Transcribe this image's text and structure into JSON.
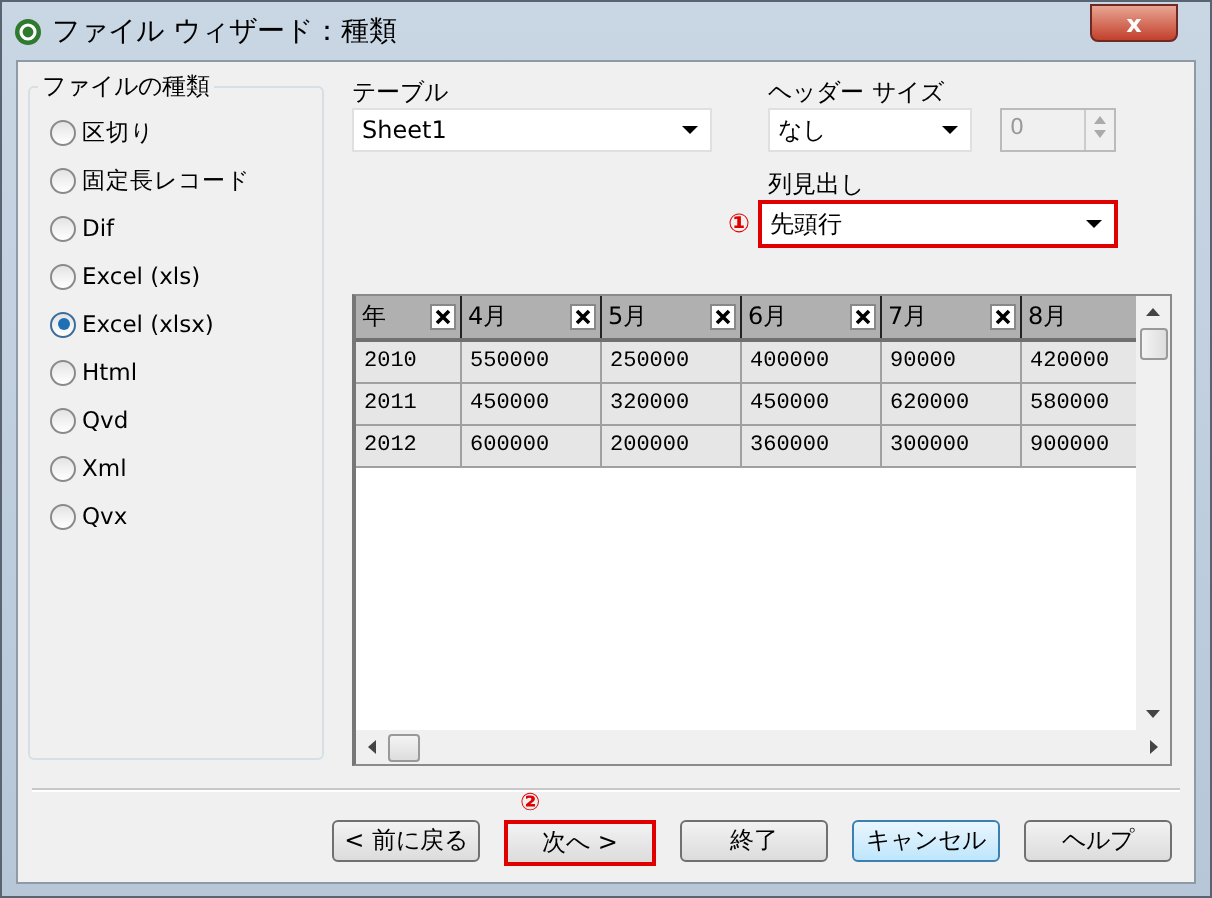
{
  "window": {
    "title": "ファイル ウィザード：種類",
    "close_label": "x"
  },
  "file_types": {
    "label": "ファイルの種類",
    "options": [
      {
        "label": "区切り",
        "selected": false
      },
      {
        "label": "固定長レコード",
        "selected": false
      },
      {
        "label": "Dif",
        "selected": false
      },
      {
        "label": "Excel (xls)",
        "selected": false
      },
      {
        "label": "Excel (xlsx)",
        "selected": true
      },
      {
        "label": "Html",
        "selected": false
      },
      {
        "label": "Qvd",
        "selected": false
      },
      {
        "label": "Xml",
        "selected": false
      },
      {
        "label": "Qvx",
        "selected": false
      }
    ]
  },
  "table_field": {
    "label": "テーブル",
    "value": "Sheet1"
  },
  "header_size": {
    "label": "ヘッダー サイズ",
    "value": "なし",
    "spin_value": "0",
    "spin_disabled": true
  },
  "column_headers": {
    "label": "列見出し",
    "value": "先頭行",
    "marker": "①",
    "annotated": true
  },
  "grid": {
    "columns": [
      "年",
      "4月",
      "5月",
      "6月",
      "7月",
      "8月"
    ],
    "rows": [
      [
        "2010",
        "550000",
        "250000",
        "400000",
        "90000",
        "420000"
      ],
      [
        "2011",
        "450000",
        "320000",
        "450000",
        "620000",
        "580000"
      ],
      [
        "2012",
        "600000",
        "200000",
        "360000",
        "300000",
        "900000"
      ]
    ]
  },
  "buttons": [
    {
      "label": "< 前に戻る",
      "default": false,
      "annotated": false
    },
    {
      "label": "次へ >",
      "default": false,
      "annotated": true,
      "marker": "②"
    },
    {
      "label": "終了",
      "default": false,
      "annotated": false
    },
    {
      "label": "キャンセル",
      "default": true,
      "annotated": false
    },
    {
      "label": "ヘルプ",
      "default": false,
      "annotated": false
    }
  ]
}
